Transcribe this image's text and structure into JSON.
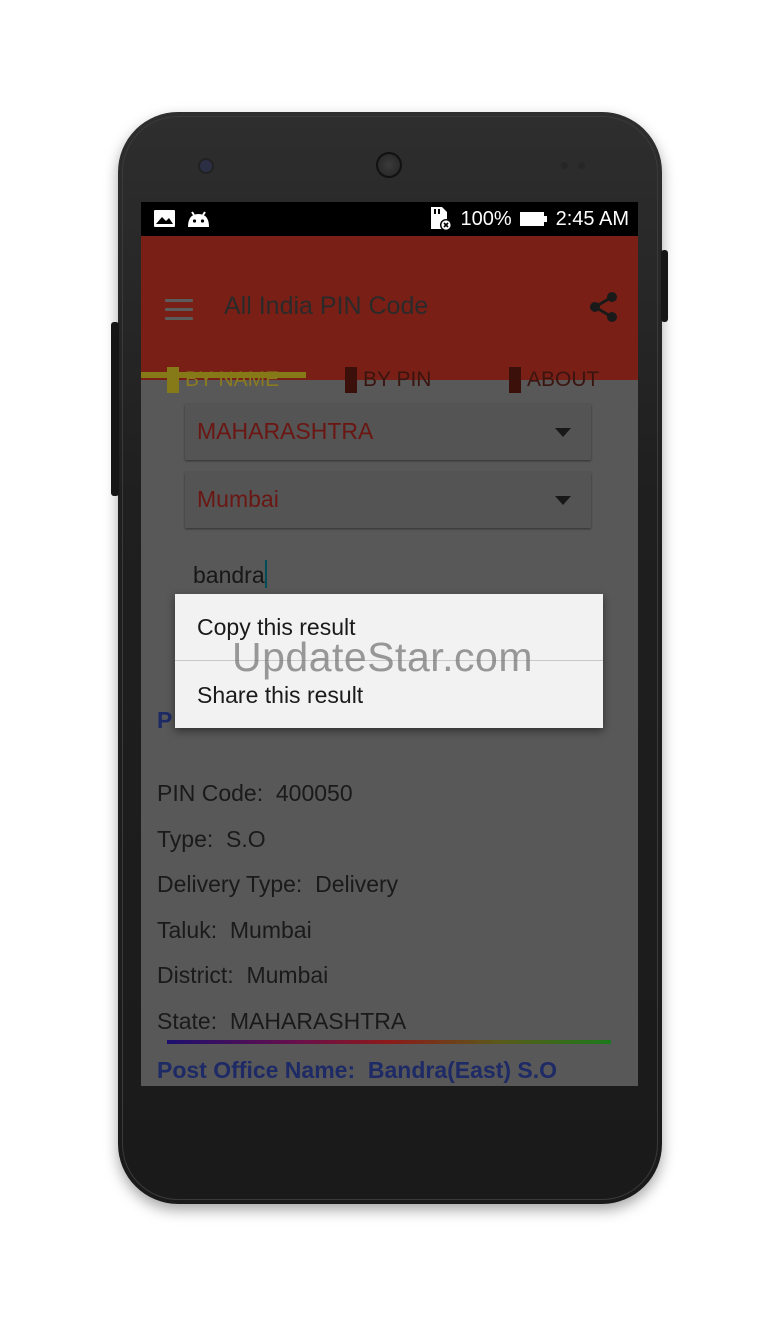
{
  "status_bar": {
    "battery_percent": "100%",
    "time": "2:45 AM",
    "left_icons": [
      "image-icon",
      "android-icon"
    ],
    "right_icons": [
      "sd-card-icon",
      "battery-icon"
    ]
  },
  "app_bar": {
    "title": "All India PIN Code",
    "color": "#7a1f16"
  },
  "tabs": [
    {
      "label": "BY NAME",
      "active": true
    },
    {
      "label": "BY PIN",
      "active": false
    },
    {
      "label": "ABOUT",
      "active": false
    }
  ],
  "form": {
    "state_value": "MAHARASHTRA",
    "city_value": "Mumbai",
    "search_value": "bandra"
  },
  "context_menu": {
    "items": [
      "Copy this result",
      "Share this result"
    ]
  },
  "result": {
    "partial_label": "P",
    "fields": [
      {
        "label": "PIN Code:",
        "value": "400050"
      },
      {
        "label": "Type:",
        "value": "S.O"
      },
      {
        "label": "Delivery Type:",
        "value": "Delivery"
      },
      {
        "label": "Taluk:",
        "value": "Mumbai"
      },
      {
        "label": "District:",
        "value": "Mumbai"
      },
      {
        "label": "State:",
        "value": "MAHARASHTRA"
      }
    ],
    "next_post_office": {
      "label": "Post Office Name:",
      "value": "Bandra(East) S.O"
    }
  },
  "watermark": "UpdateStar.com"
}
